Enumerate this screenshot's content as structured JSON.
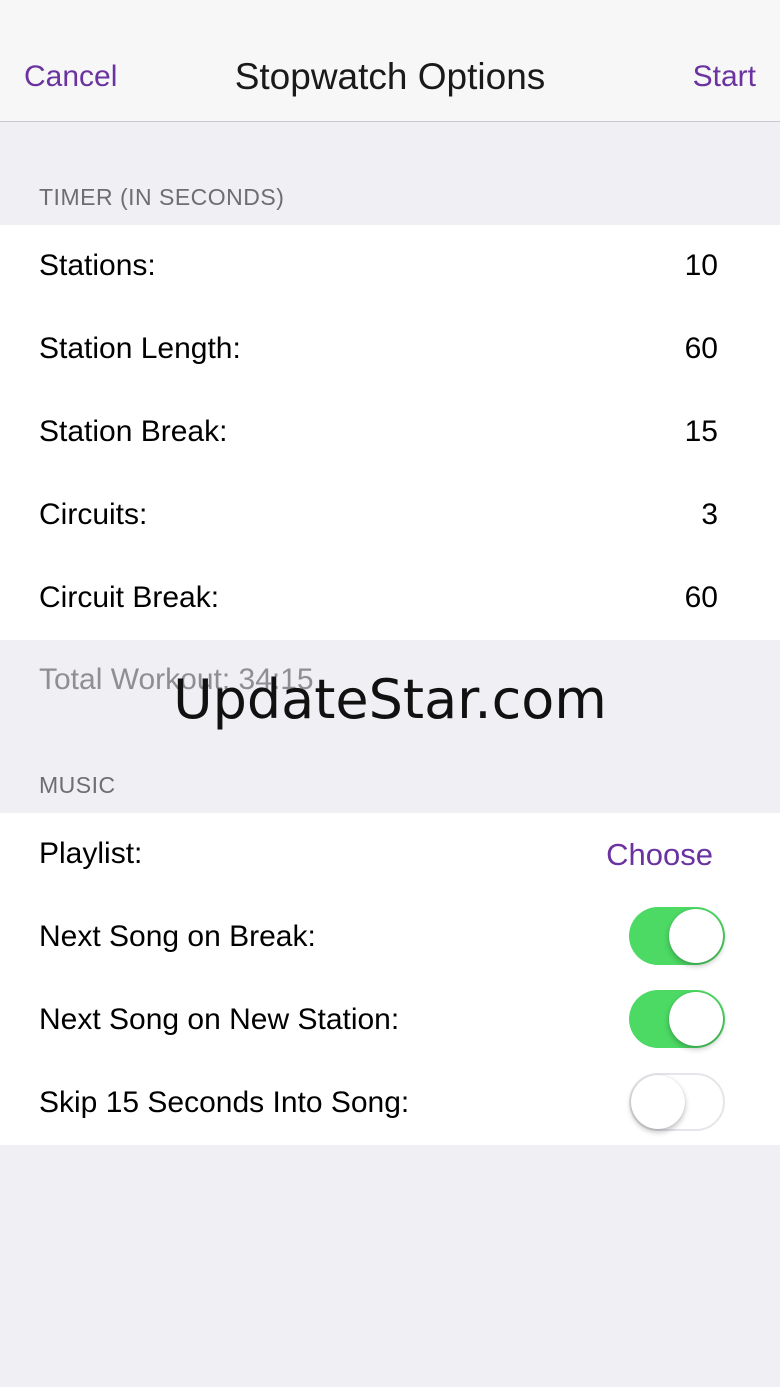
{
  "nav": {
    "cancel_label": "Cancel",
    "title": "Stopwatch Options",
    "start_label": "Start"
  },
  "timer_section": {
    "header": "TIMER (IN SECONDS)",
    "rows": [
      {
        "label": "Stations:",
        "value": "10"
      },
      {
        "label": "Station Length:",
        "value": "60"
      },
      {
        "label": "Station Break:",
        "value": "15"
      },
      {
        "label": "Circuits:",
        "value": "3"
      },
      {
        "label": "Circuit Break:",
        "value": "60"
      }
    ],
    "total_workout": "Total Workout: 34:15"
  },
  "music_section": {
    "header": "MUSIC",
    "playlist": {
      "label": "Playlist:",
      "action": "Choose"
    },
    "toggles": [
      {
        "label": "Next Song on Break:",
        "on": true
      },
      {
        "label": "Next Song on New Station:",
        "on": true
      },
      {
        "label": "Skip 15 Seconds Into Song:",
        "on": false
      }
    ]
  },
  "watermark": "UpdateStar.com",
  "colors": {
    "accent": "#6a33a0",
    "toggle_on": "#4cd964",
    "background": "#efeff4"
  }
}
